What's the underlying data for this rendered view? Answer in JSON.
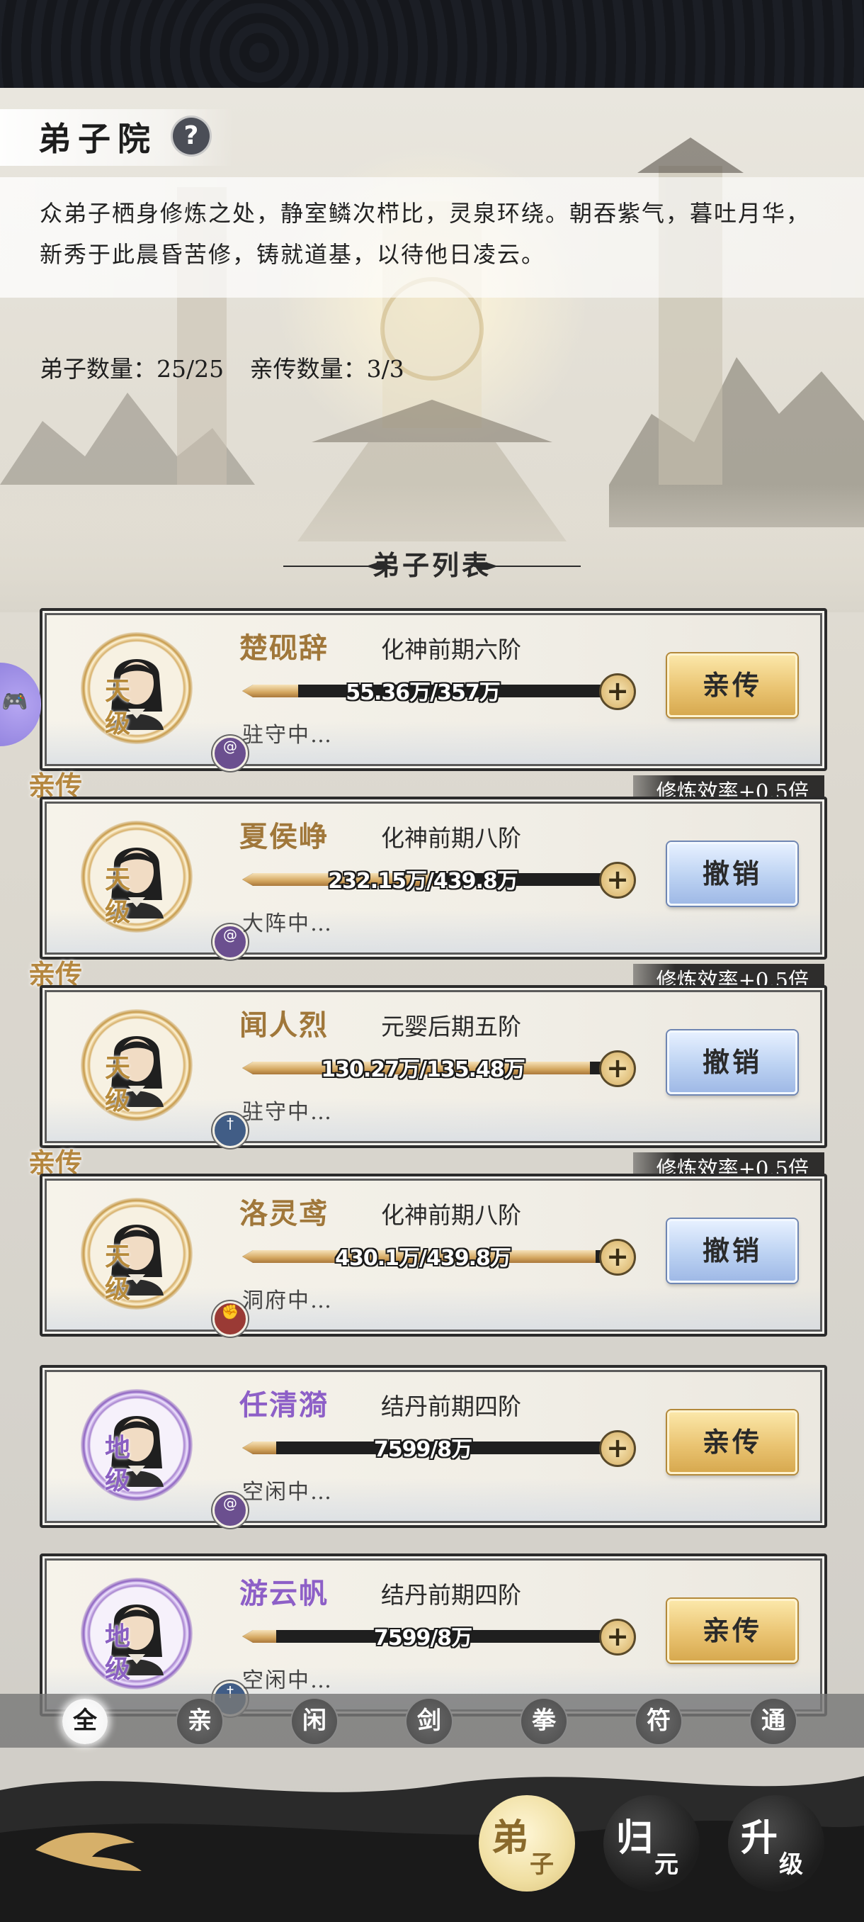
{
  "header": {
    "title": "弟子院",
    "help_icon": "?",
    "description": "众弟子栖身修炼之处，静室鳞次栉比，灵泉环绕。朝吞紫气，暮吐月华，新秀于此晨昏苦修，铸就道基，以待他日凌云。",
    "disciple_count_label": "弟子数量：25/25",
    "direct_count_label": "亲传数量：3/3"
  },
  "list": {
    "title": "弟子列表",
    "direct_tag": "亲传",
    "efficiency_tag": "修炼效率+0.5倍",
    "disciples": [
      {
        "name": "楚砚辞",
        "realm": "化神前期六阶",
        "rank": [
          "天",
          "级"
        ],
        "rank_color": "#b78a3a",
        "progress_text": "55.36万/357万",
        "progress": 0.155,
        "status": "驻守中…",
        "action": "亲传",
        "action_style": "gold",
        "is_direct": false,
        "sect_icon": "swirl-icon"
      },
      {
        "name": "夏侯峥",
        "realm": "化神前期八阶",
        "rank": [
          "天",
          "级"
        ],
        "rank_color": "#b78a3a",
        "progress_text": "232.15万/439.8万",
        "progress": 0.528,
        "status": "大阵中…",
        "action": "撤销",
        "action_style": "blue",
        "is_direct": true,
        "sect_icon": "swirl-icon"
      },
      {
        "name": "闻人烈",
        "realm": "元婴后期五阶",
        "rank": [
          "天",
          "级"
        ],
        "rank_color": "#b78a3a",
        "progress_text": "130.27万/135.48万",
        "progress": 0.962,
        "status": "驻守中…",
        "action": "撤销",
        "action_style": "blue",
        "is_direct": true,
        "sect_icon": "sword-icon"
      },
      {
        "name": "洛灵鸢",
        "realm": "化神前期八阶",
        "rank": [
          "天",
          "级"
        ],
        "rank_color": "#b78a3a",
        "progress_text": "430.1万/439.8万",
        "progress": 0.978,
        "status": "洞府中…",
        "action": "撤销",
        "action_style": "blue",
        "is_direct": true,
        "sect_icon": "fist-icon"
      },
      {
        "name": "任清漪",
        "realm": "结丹前期四阶",
        "rank": [
          "地",
          "级"
        ],
        "rank_color": "#8a5fc2",
        "progress_text": "7599/8万",
        "progress": 0.095,
        "status": "空闲中…",
        "action": "亲传",
        "action_style": "gold",
        "is_direct": false,
        "sect_icon": "swirl-icon"
      },
      {
        "name": "游云帆",
        "realm": "结丹前期四阶",
        "rank": [
          "地",
          "级"
        ],
        "rank_color": "#8a5fc2",
        "progress_text": "7599/8万",
        "progress": 0.095,
        "status": "空闲中…",
        "action": "亲传",
        "action_style": "gold",
        "is_direct": false,
        "sect_icon": "sword-icon"
      }
    ]
  },
  "filters": [
    "全",
    "亲",
    "闲",
    "剑",
    "拳",
    "符",
    "通"
  ],
  "active_filter": "全",
  "bottom_nav": [
    {
      "big": "弟",
      "small": "子"
    },
    {
      "big": "归",
      "small": "元"
    },
    {
      "big": "升",
      "small": "级"
    }
  ]
}
